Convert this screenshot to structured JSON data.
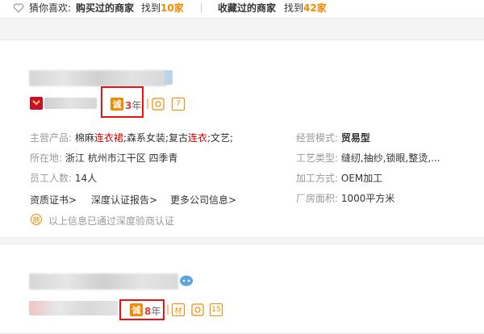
{
  "topbar": {
    "guess_label": "猜你喜欢:",
    "bought_label": "购买过的商家",
    "found_prefix": "找到",
    "bought_count": "10家",
    "fav_label": "收藏过的商家",
    "fav_count": "42家"
  },
  "cards": [
    {
      "cheng_badge": "诚",
      "years_num": "3",
      "years_unit": "年",
      "mini_badges": [
        "7"
      ],
      "main_products_label": "主营产品:",
      "main_products": [
        {
          "t": "棉麻",
          "red": false
        },
        {
          "t": "连衣裙",
          "red": true
        },
        {
          "t": ";森系女装;复古",
          "red": false
        },
        {
          "t": "连衣",
          "red": true
        },
        {
          "t": ";文艺;",
          "red": false
        }
      ],
      "location_label": "所在地:",
      "location": "浙江 杭州市江干区 四季青",
      "employees_label": "员工人数:",
      "employees": "14人",
      "mode_label": "经营模式:",
      "mode": "贸易型",
      "process_label": "工艺类型:",
      "process": "缝纫,抽纱,锁眼,整烫,...",
      "processing_label": "加工方式:",
      "processing": "OEM加工",
      "area_label": "厂房面积:",
      "area": "1000平方米",
      "links": [
        "资质证书>",
        "深度认证报告>",
        "更多公司信息>"
      ],
      "verify_badge": "商",
      "verify_text": "以上信息已通过深度验商认证"
    },
    {
      "cheng_badge": "诚",
      "years_num": "8",
      "years_unit": "年",
      "mini_badges": [
        "材",
        "15"
      ]
    }
  ],
  "colors": {
    "accent": "#f08a00",
    "highlight": "#ee1111",
    "red_text": "#cc0000"
  }
}
